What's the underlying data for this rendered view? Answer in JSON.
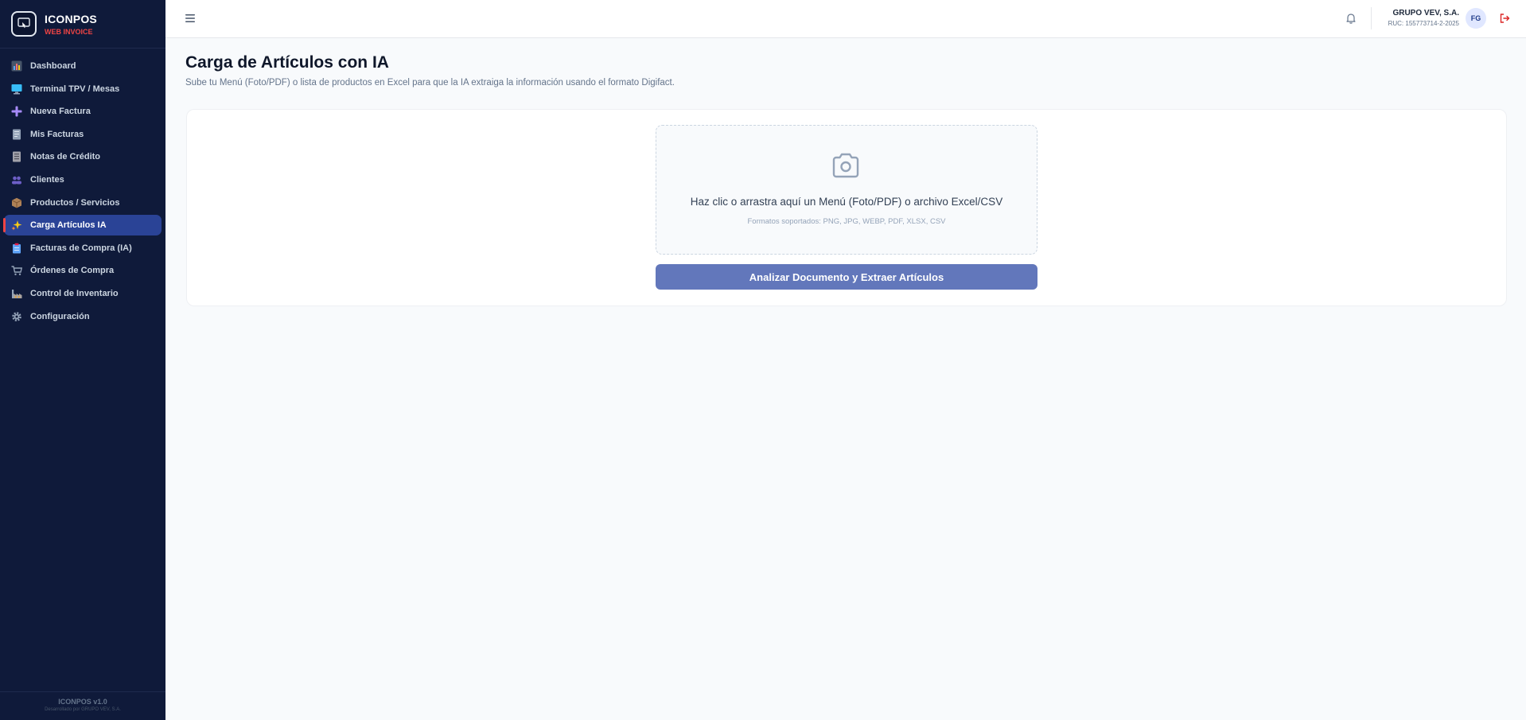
{
  "brand": {
    "name": "ICONPOS",
    "subtitle": "WEB INVOICE"
  },
  "sidebar": {
    "items": [
      {
        "label": "Dashboard",
        "icon": "bar-chart-icon",
        "color": "#64748b"
      },
      {
        "label": "Terminal TPV / Mesas",
        "icon": "monitor-icon",
        "color": "#38bdf8"
      },
      {
        "label": "Nueva Factura",
        "icon": "plus-icon",
        "color": "#a78bfa"
      },
      {
        "label": "Mis Facturas",
        "icon": "document-icon",
        "color": "#94a3b8"
      },
      {
        "label": "Notas de Crédito",
        "icon": "receipt-icon",
        "color": "#94a3b8"
      },
      {
        "label": "Clientes",
        "icon": "users-icon",
        "color": "#6d5fc7"
      },
      {
        "label": "Productos / Servicios",
        "icon": "package-icon",
        "color": "#b08257"
      },
      {
        "label": "Carga Artículos IA",
        "icon": "sparkles-icon",
        "color": "#facc15",
        "active": true
      },
      {
        "label": "Facturas de Compra (IA)",
        "icon": "clipboard-icon",
        "color": "#60a5fa"
      },
      {
        "label": "Órdenes de Compra",
        "icon": "cart-icon",
        "color": "#94a3b8"
      },
      {
        "label": "Control de Inventario",
        "icon": "factory-icon",
        "color": "#94a3b8"
      },
      {
        "label": "Configuración",
        "icon": "gear-icon",
        "color": "#94a3b8"
      }
    ],
    "footer": {
      "version": "ICONPOS v1.0",
      "developer": "Desarrollado por GRUPO VEV, S.A."
    }
  },
  "topbar": {
    "company_name": "GRUPO VEV, S.A.",
    "ruc": "RUC: 155773714-2-2025",
    "avatar_initials": "FG"
  },
  "main": {
    "title": "Carga de Artículos con IA",
    "subtitle": "Sube tu Menú (Foto/PDF) o lista de productos en Excel para que la IA extraiga la información usando el formato Digifact.",
    "dropzone": {
      "text": "Haz clic o arrastra aquí un Menú (Foto/PDF) o archivo Excel/CSV",
      "formats": "Formatos soportados: PNG, JPG, WEBP, PDF, XLSX, CSV"
    },
    "analyze_button": "Analizar Documento y Extraer Artículos"
  },
  "colors": {
    "sidebar_bg": "#0f1a3a",
    "active_item": "#2a4396",
    "accent_red": "#ef4444",
    "button": "#6277bb"
  }
}
